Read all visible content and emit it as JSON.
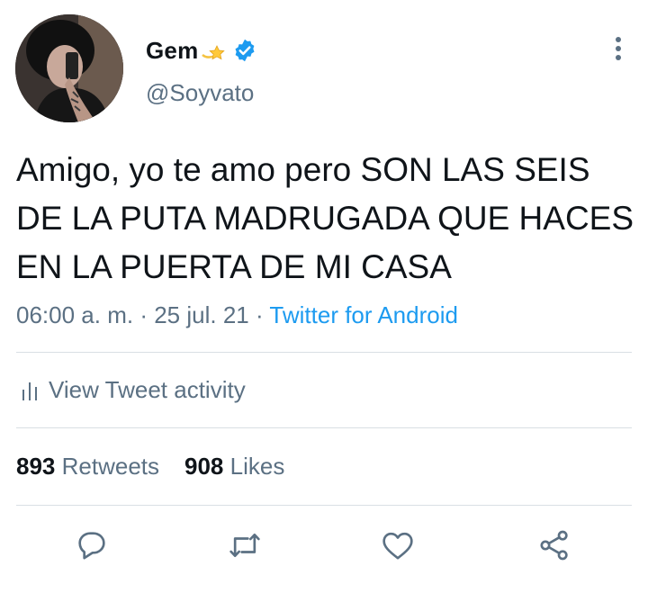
{
  "author": {
    "name": "Gem",
    "handle": "@Soyvato",
    "avatar_icon": "profile-photo",
    "name_emoji_icon": "dizzy-star-icon",
    "verified_icon": "verified-badge-icon"
  },
  "tweet": {
    "text": "Amigo, yo te amo pero SON LAS SEIS DE LA PUTA MADRUGADA QUE HACES EN LA PUERTA DE MI CASA",
    "time": "06:00 a. m.",
    "separator": "·",
    "date": "25 jul. 21",
    "source": "Twitter for Android"
  },
  "activity": {
    "label": "View Tweet activity",
    "icon": "bar-chart-icon"
  },
  "stats": {
    "retweets_count": "893",
    "retweets_label": "Retweets",
    "likes_count": "908",
    "likes_label": "Likes"
  },
  "actions": {
    "reply_icon": "reply-icon",
    "retweet_icon": "retweet-icon",
    "like_icon": "heart-icon",
    "share_icon": "share-icon",
    "more_icon": "more-vertical-icon"
  },
  "colors": {
    "text": "#0f1419",
    "secondary": "#5b7083",
    "link": "#1d9bf0",
    "divider": "#d9dfe4",
    "verified": "#1d9bf0"
  }
}
